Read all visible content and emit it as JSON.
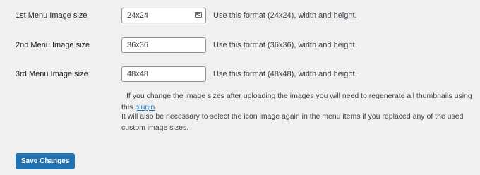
{
  "settings": {
    "rows": [
      {
        "label": "1st Menu Image size",
        "value": "24x24",
        "hint": "Use this format (24x24), width and height."
      },
      {
        "label": "2nd Menu Image size",
        "value": "36x36",
        "hint": "Use this format (36x36), width and height."
      },
      {
        "label": "3rd Menu Image size",
        "value": "48x48",
        "hint": "Use this format (48x48), width and height."
      }
    ],
    "note": {
      "line1_prefix": "If you change the image sizes after uploading the images you will need to regenerate all thumbnails using this",
      "link_text": "plugin",
      "link_suffix": ".",
      "line2": "It will also be necessary to select the icon image again in the menu items if you replaced any of the used custom image sizes."
    }
  },
  "actions": {
    "save_label": "Save Changes"
  },
  "colors": {
    "background": "#f0f0f1",
    "primary": "#2271b1",
    "text": "#1d2327",
    "input_border": "#8c8f94"
  },
  "icons": {
    "autofill": "contact-card-icon"
  }
}
